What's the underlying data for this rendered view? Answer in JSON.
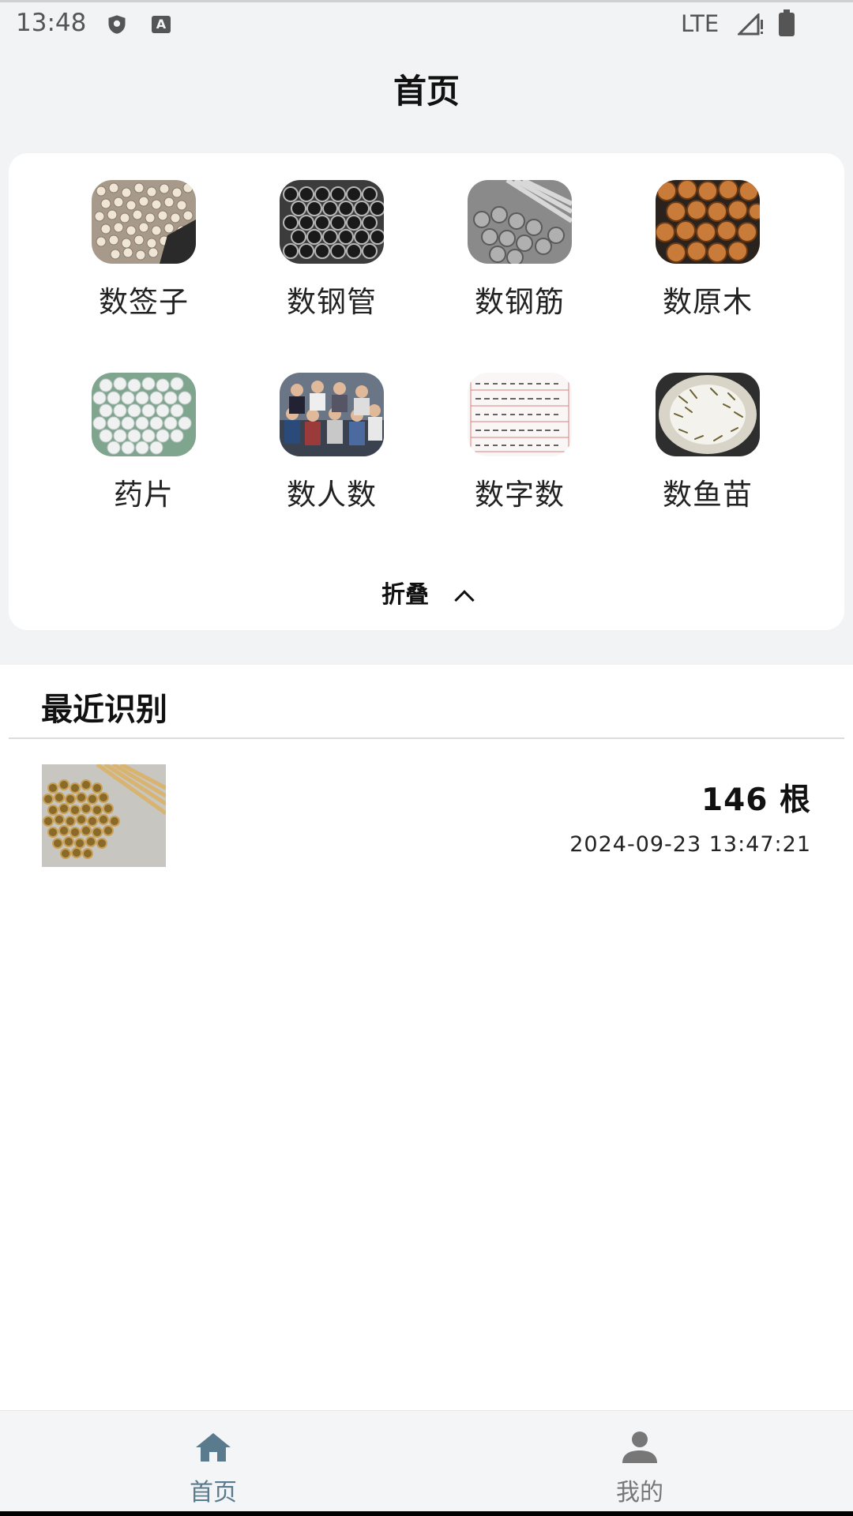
{
  "status_bar": {
    "time": "13:48",
    "network": "LTE"
  },
  "header": {
    "title": "首页"
  },
  "categories": [
    {
      "label": "数签子",
      "icon": "bamboo-sticks-photo"
    },
    {
      "label": "数钢管",
      "icon": "steel-pipes-photo"
    },
    {
      "label": "数钢筋",
      "icon": "steel-bars-photo"
    },
    {
      "label": "数原木",
      "icon": "logs-photo"
    },
    {
      "label": "药片",
      "icon": "pills-photo"
    },
    {
      "label": "数人数",
      "icon": "people-photo"
    },
    {
      "label": "数字数",
      "icon": "handwriting-photo"
    },
    {
      "label": "数鱼苗",
      "icon": "fish-fry-photo"
    }
  ],
  "collapse": {
    "label": "折叠"
  },
  "recent": {
    "title": "最近识别",
    "items": [
      {
        "count": "146 根",
        "time": "2024-09-23 13:47:21",
        "thumb": "bamboo-bundle-photo"
      }
    ]
  },
  "nav": {
    "home_label": "首页",
    "profile_label": "我的",
    "active_color": "#5a7a8e",
    "inactive_color": "#777777"
  }
}
